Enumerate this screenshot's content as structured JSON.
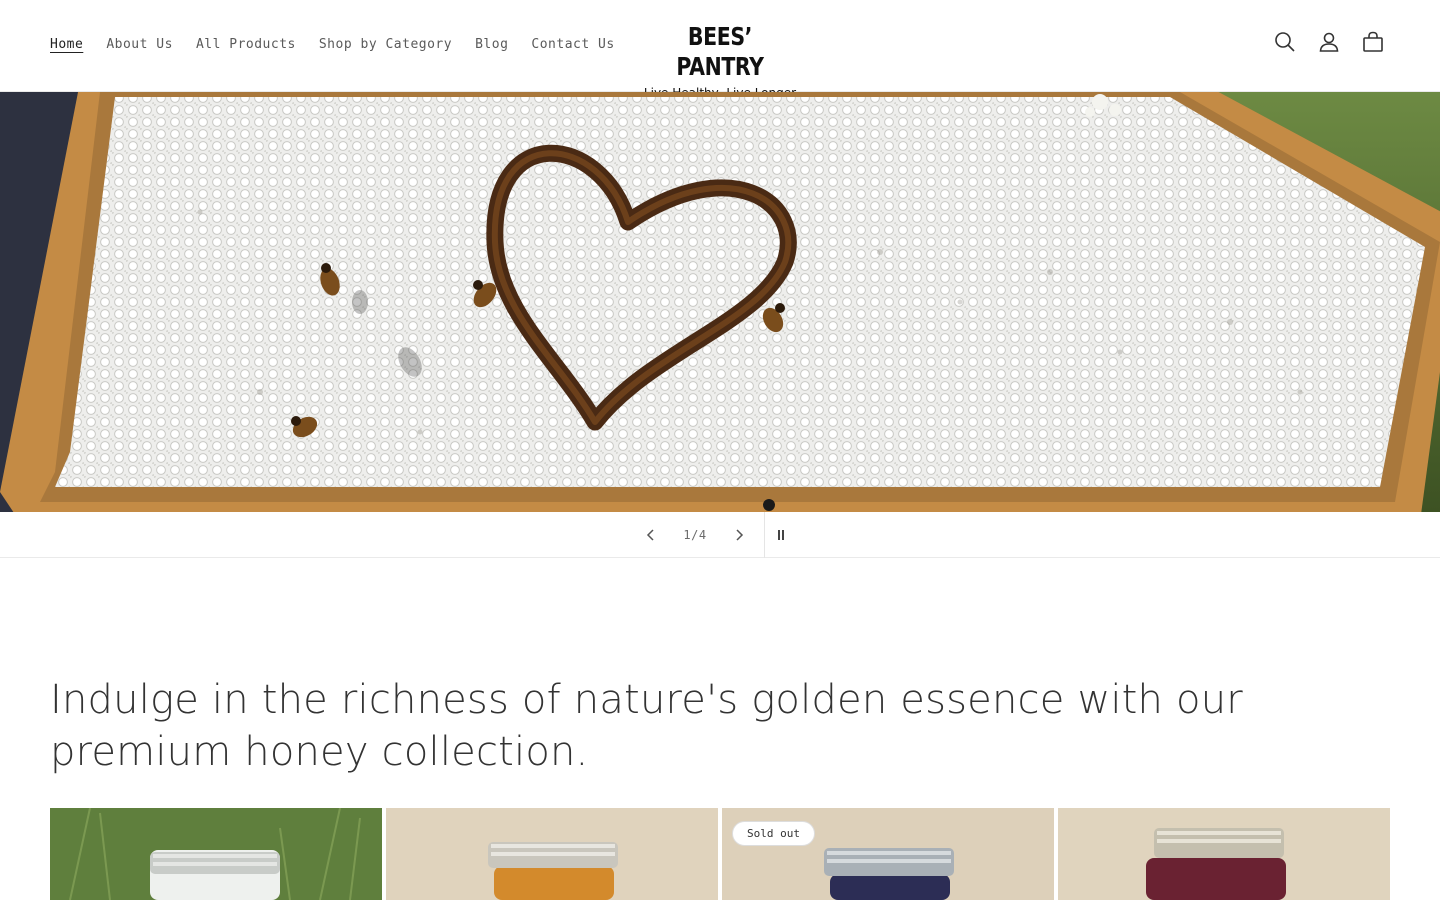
{
  "nav": {
    "items": [
      {
        "label": "Home",
        "active": true
      },
      {
        "label": "About Us",
        "active": false
      },
      {
        "label": "All Products",
        "active": false
      },
      {
        "label": "Shop by Category",
        "active": false
      },
      {
        "label": "Blog",
        "active": false
      },
      {
        "label": "Contact Us",
        "active": false
      }
    ]
  },
  "logo": {
    "title": "BEES’ PANTRY",
    "tagline": "Live Healthy, Live Longer"
  },
  "header_icons": [
    "search-icon",
    "account-icon",
    "cart-icon"
  ],
  "slideshow": {
    "counter": "1/4",
    "current": 1,
    "total": 4
  },
  "headline": "Indulge in the richness of nature's golden essence with our premium honey collection.",
  "products": [
    {
      "badge": "",
      "jar_color": "#e9ecea",
      "bg": "#5b7d3a"
    },
    {
      "badge": "",
      "jar_color": "#d38a2c",
      "bg": "#d9cbb3"
    },
    {
      "badge": "Sold out",
      "jar_color": "#2c2d55",
      "bg": "#d7c9b1"
    },
    {
      "badge": "",
      "jar_color": "#6a2232",
      "bg": "#d9cbb4"
    }
  ],
  "colors": {
    "text_primary": "#333333",
    "nav_text": "#5a5a5a",
    "border": "#eaeaea"
  }
}
